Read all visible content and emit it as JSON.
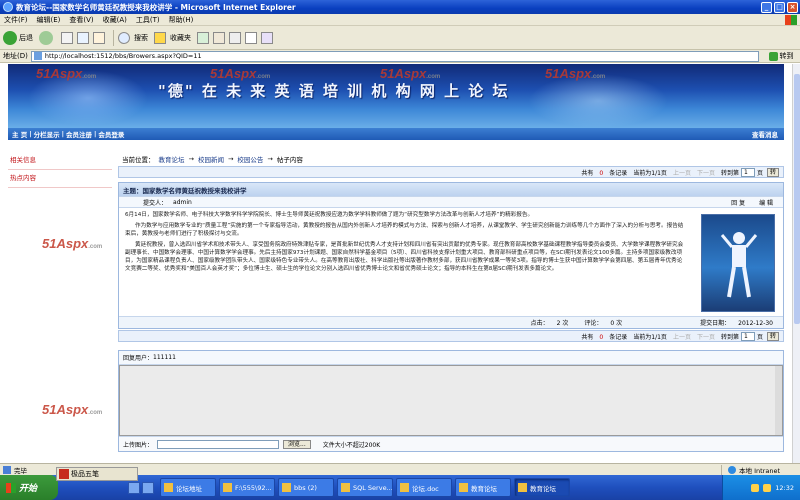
{
  "window": {
    "title": "教育论坛--国家数学名师黄廷祝教授来我校讲学 - Microsoft Internet Explorer",
    "controls": [
      "_",
      "□",
      "×"
    ]
  },
  "menu": [
    "文件(F)",
    "编辑(E)",
    "查看(V)",
    "收藏(A)",
    "工具(T)",
    "帮助(H)"
  ],
  "toolbar": {
    "back": "后退",
    "search": "搜索",
    "favorites": "收藏夹"
  },
  "address": {
    "label": "地址(D)",
    "url": "http://localhost:1512/bbs/Browers.aspx?QID=11",
    "go": "转到"
  },
  "banner": {
    "slogan": "\"德\" 在 未 来 英 语 培 训 机 构 网 上 论 坛"
  },
  "watermark": {
    "brand": "51Aspx",
    "suffix": ".com"
  },
  "nav": {
    "items": [
      "主 页",
      "分栏显示",
      "会员注册",
      "会员登录"
    ],
    "separator": "|",
    "right": "查看消息"
  },
  "sidebar": [
    "相关信息",
    "热点内容"
  ],
  "breadcrumb": {
    "prefix": "当前位置：",
    "items": [
      "教育论坛",
      "校园新闻",
      "校园公告",
      "帖子内容"
    ],
    "arrow": "→"
  },
  "pager": {
    "total_pre": "共有",
    "total_count": "0",
    "total_post": "条记录",
    "page_info": "当前为1/1页",
    "prev": "上一页",
    "next": "下一页",
    "goto_pre": "转到第",
    "goto_value": "1",
    "goto_post": "页",
    "goto_btn": "转"
  },
  "topic": {
    "title": "主题：国家数学名师黄廷祝教授来我校讲学",
    "author_label": "提交人：",
    "author": "admin",
    "reply": "回 复",
    "edit": "编 辑",
    "paragraphs": [
      "6月14日，国家数学名师、电子科技大学数学科学学院院长、博士生导师黄廷祝教授应邀为数学学科教师做了题为“研究型数学方法改革与创新人才培养”的精彩报告。",
      "作为数学与应用数学专业的“质量工程”实施的第一个专家指导活动，黄教授的报告从国内外创新人才培养的模式与方法、探索与创新人才培养，从课堂教学、学生研究创新能力训练等几个方面作了深入的分析与思考。报告结束后，黄教授与老师们进行了积极探讨与交流。",
      "黄廷祝教授，曾入选四川省学术和技术带头人、享受国务院政府特殊津贴专家，是首批新世纪优秀人才支持计划和四川省有突出贡献的优秀专家。现任教育部高校数学基础课程教学指导委员会委员、大学数学课程教学研究会副理事长、中国数学会理事、中国计算数学学会理事。先后主持国家973计划课题、国家自然科学基金项目（5项）、四川省科技支撑计划重大项目、教育部科研重点项目等，在SCI期刊发表论文100多篇。主持多项国家级教改项目，为国家精品课程负责人、国家级教学团队带头人、国家级特色专业带头人。在高等教育出版社、科学出版社等出版著作教材多部，获四川省教学成果一等奖3项。指导的博士生获中国计算数学学会第四届、第五届青年优秀论文竞赛二等奖、优秀奖和“美国百人会英才奖”；多位博士生、硕士生的学位论文分别入选四川省优秀博士论文和省优秀硕士论文；指导的本科生在第8届SCI期刊发表多篇论文。"
    ],
    "footer": {
      "clicks_label": "点击：",
      "clicks": "2 次",
      "comments_label": "评论：",
      "comments": "0 次",
      "date_label": "提交日期：",
      "date": "2012-12-30"
    }
  },
  "reply_form": {
    "user_label": "回复用户：",
    "user": "111111",
    "upload_label": "上传图片：",
    "browse": "浏览...",
    "hint": "文件大小不超过200K"
  },
  "status": {
    "text": "完毕",
    "zone": "本地 Intranet"
  },
  "ime": {
    "label": "极品五笔"
  },
  "taskbar": {
    "start": "开始",
    "tasks": [
      "论坛地址",
      "F:\\555\\92...",
      "bbs (2)",
      "SQL Serve...",
      "论坛.doc",
      "教育论坛",
      "教育论坛"
    ],
    "active_index": 6,
    "clock": "12:32"
  }
}
